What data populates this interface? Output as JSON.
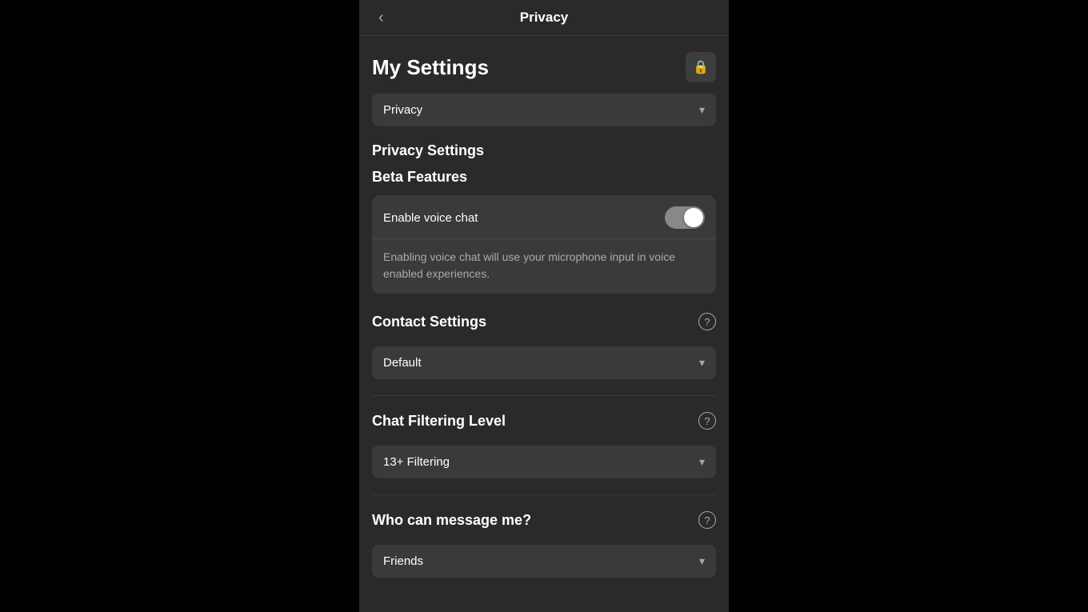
{
  "header": {
    "back_label": "‹",
    "title": "Privacy"
  },
  "my_settings": {
    "title": "My Settings",
    "lock_icon": "🔒",
    "dropdown": {
      "value": "Privacy",
      "arrow": "▾"
    }
  },
  "privacy_settings": {
    "section_title": "Privacy Settings",
    "beta_features": {
      "section_title": "Beta Features",
      "enable_voice_chat_label": "Enable voice chat",
      "description": "Enabling voice chat will use your microphone input in voice enabled experiences."
    },
    "contact_settings": {
      "section_title": "Contact Settings",
      "help_icon": "?",
      "dropdown": {
        "value": "Default",
        "arrow": "▾"
      }
    },
    "chat_filtering": {
      "section_title": "Chat Filtering Level",
      "help_icon": "?",
      "dropdown": {
        "value": "13+ Filtering",
        "arrow": "▾"
      }
    },
    "who_can_message": {
      "section_title": "Who can message me?",
      "help_icon": "?",
      "dropdown": {
        "value": "Friends",
        "arrow": "▾"
      }
    }
  }
}
